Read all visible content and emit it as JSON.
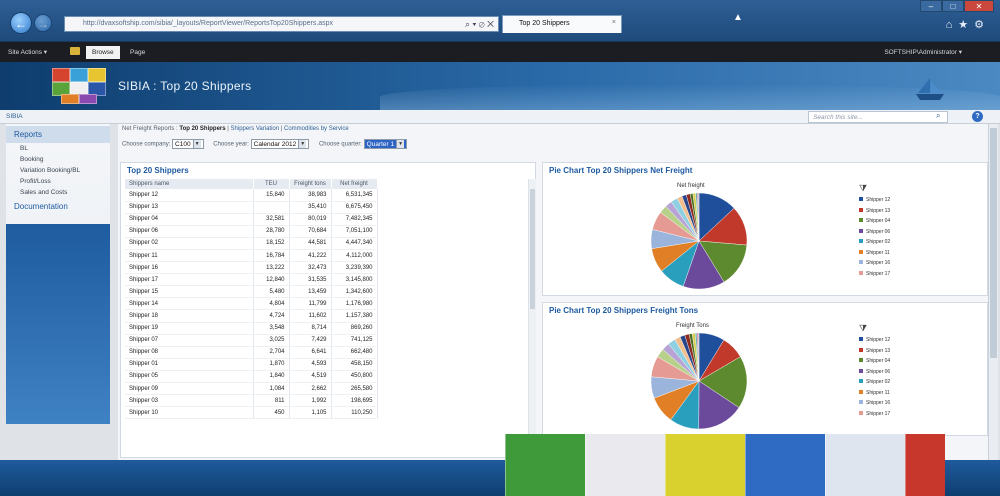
{
  "browser": {
    "url": "http://dvaxsoftship.com/sibia/_layouts/ReportViewer/ReportsTop20Shippers.aspx",
    "tab_title": "Top 20 Shippers",
    "addr_controls": "⌕ ▾ ⊘ ✕",
    "tab_close": "×",
    "min": "–",
    "max": "□",
    "close": "✕",
    "tools": "⌂★⚙"
  },
  "ribbon": {
    "site_actions": "Site Actions ▾",
    "tab_browse": "Browse",
    "tab_page": "Page",
    "user": "SOFTSHIP\\Administrator ▾"
  },
  "banner": {
    "title": "SIBIA : Top 20 Shippers"
  },
  "crumb": {
    "home": "SIBIA",
    "search_placeholder": "Search this site...",
    "search_glyph": "⌕",
    "help_glyph": "?"
  },
  "leftnav": {
    "reports_heading": "Reports",
    "items": [
      "BL",
      "Booking",
      "Variation Booking/BL",
      "Profit/Loss",
      "Sales and Costs"
    ],
    "documentation_heading": "Documentation"
  },
  "report_links": {
    "parent": "Net Freight Reports",
    "sep": " : ",
    "current": "Top 20 Shippers",
    "bar": " | ",
    "variation": "Shippers Variation",
    "commodities": "Commodities by Service"
  },
  "filters": {
    "company_label": "Choose company:",
    "company_value": "C100",
    "year_label": "Choose year:",
    "year_value": "Calendar 2012",
    "quarter_label": "Choose quarter:",
    "quarter_value": "Quarter 1",
    "dropdown_glyph": "▼"
  },
  "table": {
    "title": "Top 20 Shippers",
    "columns": [
      "Shippers name",
      "TEU",
      "Freight tons",
      "Net freight"
    ],
    "rows": [
      [
        "Shipper 12",
        "15,840",
        "38,983",
        "6,531,345"
      ],
      [
        "Shipper 13",
        "",
        "35,410",
        "6,675,450"
      ],
      [
        "Shipper 04",
        "32,581",
        "80,019",
        "7,482,345"
      ],
      [
        "Shipper 06",
        "28,780",
        "70,684",
        "7,051,100"
      ],
      [
        "Shipper 02",
        "18,152",
        "44,581",
        "4,447,340"
      ],
      [
        "Shipper 11",
        "16,784",
        "41,222",
        "4,112,000"
      ],
      [
        "Shipper 16",
        "13,222",
        "32,473",
        "3,239,390"
      ],
      [
        "Shipper 17",
        "12,840",
        "31,535",
        "3,145,800"
      ],
      [
        "Shipper 15",
        "5,480",
        "13,459",
        "1,342,600"
      ],
      [
        "Shipper 14",
        "4,804",
        "11,799",
        "1,176,980"
      ],
      [
        "Shipper 18",
        "4,724",
        "11,602",
        "1,157,380"
      ],
      [
        "Shipper 19",
        "3,548",
        "8,714",
        "869,260"
      ],
      [
        "Shipper 07",
        "3,025",
        "7,429",
        "741,125"
      ],
      [
        "Shipper 08",
        "2,704",
        "6,641",
        "662,480"
      ],
      [
        "Shipper 01",
        "1,870",
        "4,593",
        "458,150"
      ],
      [
        "Shipper 05",
        "1,840",
        "4,519",
        "450,800"
      ],
      [
        "Shipper 09",
        "1,084",
        "2,662",
        "265,580"
      ],
      [
        "Shipper 03",
        "811",
        "1,992",
        "198,695"
      ],
      [
        "Shipper 10",
        "450",
        "1,105",
        "110,250"
      ]
    ]
  },
  "pie_net": {
    "panel_title": "Pie Chart Top 20 Shippers Net Freight",
    "chart_label": "Net freight",
    "filter_glyph": "⧩"
  },
  "pie_tons": {
    "panel_title": "Pie Chart Top 20 Shippers Freight Tons",
    "chart_label": "Freight Tons",
    "filter_glyph": "⧩"
  },
  "legend": {
    "items": [
      "Shipper 12",
      "Shipper 13",
      "Shipper 04",
      "Shipper 06",
      "Shipper 02",
      "Shipper 11",
      "Shipper 16",
      "Shipper 17"
    ],
    "colors": [
      "#1f4e9a",
      "#c0392b",
      "#5d8a2e",
      "#6b4a9b",
      "#2a9fbd",
      "#e07f26",
      "#9bb4db",
      "#e59a94"
    ]
  },
  "slice_colors": [
    "#1f4e9a",
    "#c0392b",
    "#5d8a2e",
    "#6b4a9b",
    "#2a9fbd",
    "#e07f26",
    "#9bb4db",
    "#e59a94",
    "#b7d08a",
    "#b7a4d4",
    "#8ed0e2",
    "#f2be8b",
    "#27458a",
    "#8e2a20",
    "#486d23",
    "#d4cf4e",
    "#5fb0a3",
    "#d66b9e",
    "#7a7a7a",
    "#f0d68a"
  ]
}
